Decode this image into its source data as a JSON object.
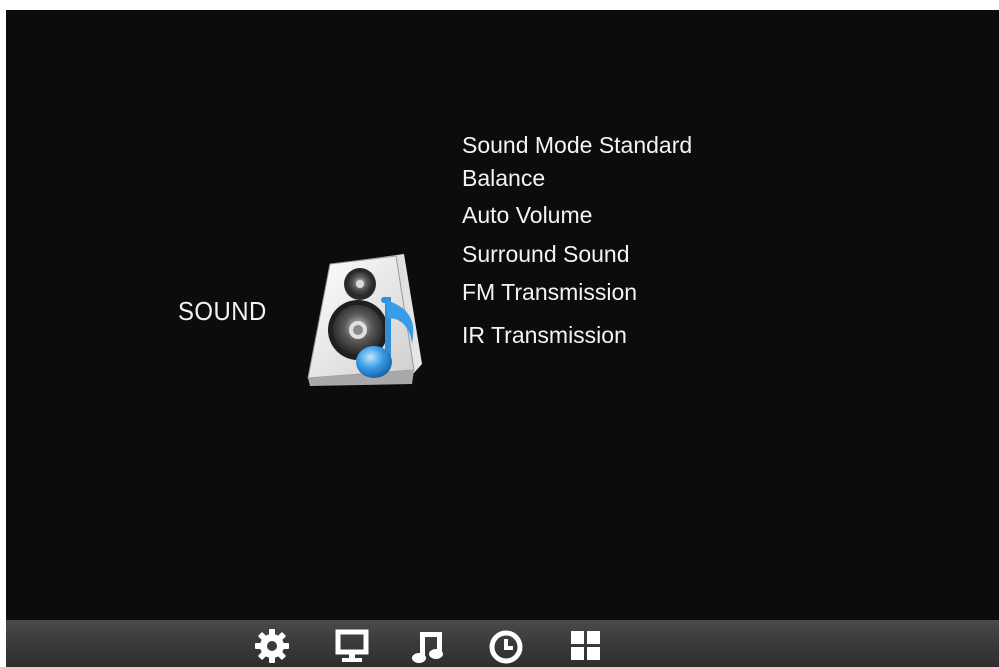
{
  "screen": {
    "section_title": "SOUND",
    "section_icon": "speaker-music-note-icon"
  },
  "menu": {
    "items": [
      {
        "label": "Sound Mode Standard"
      },
      {
        "label": "Balance"
      },
      {
        "label": "Auto Volume"
      },
      {
        "label": "Surround Sound"
      },
      {
        "label": "FM Transmission"
      },
      {
        "label": "IR Transmission"
      }
    ]
  },
  "bottom_bar": {
    "icons": [
      "gear-icon",
      "monitor-icon",
      "music-note-icon",
      "clock-icon",
      "grid-icon"
    ]
  },
  "colors": {
    "background": "#0c0c0c",
    "text": "#f4f4f4",
    "accent_blue": "#2f8fd8"
  }
}
